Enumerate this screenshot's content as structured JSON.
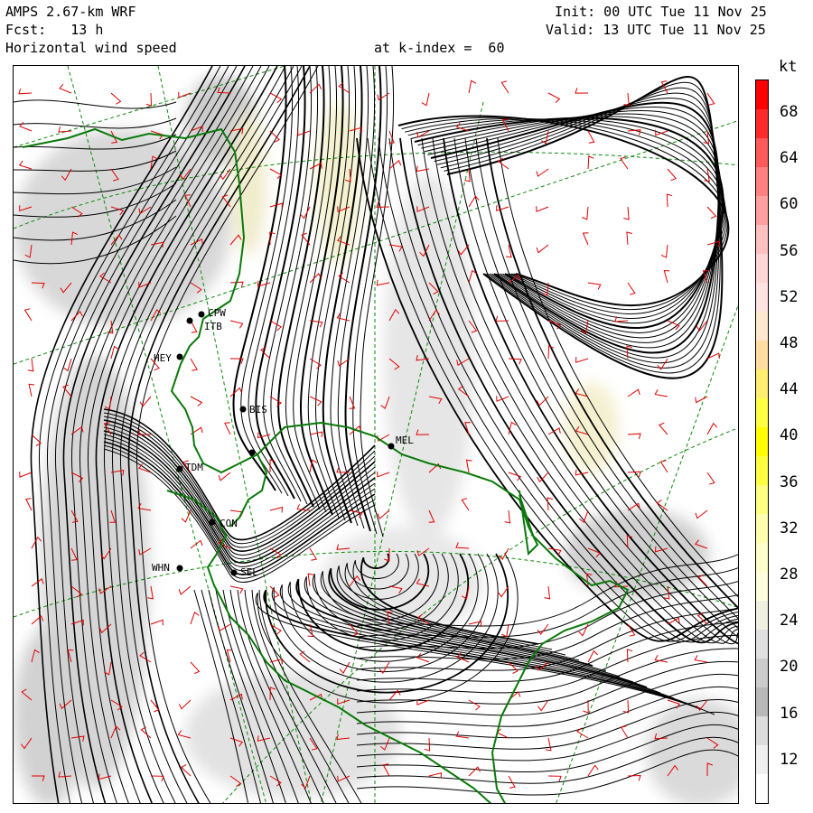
{
  "header": {
    "model": "AMPS 2.67-km WRF",
    "forecast": "Fcst:   13 h",
    "field": "Horizontal wind speed",
    "level": "at k-index =  60",
    "init": "Init: 00 UTC Tue 11 Nov 25",
    "valid": "Valid: 13 UTC Tue 11 Nov 25"
  },
  "colorbar": {
    "unit": "kt",
    "ticks": [
      "68",
      "64",
      "60",
      "56",
      "52",
      "48",
      "44",
      "40",
      "36",
      "32",
      "28",
      "24",
      "20",
      "16",
      "12"
    ],
    "colors": [
      "#ff0000",
      "#ff2a2a",
      "#ff5a5a",
      "#ff8080",
      "#ffa0a0",
      "#ffc0c0",
      "#ffd6d6",
      "#ffe2e2",
      "#ffe8cc",
      "#ffdda0",
      "#ffee70",
      "#ffff44",
      "#ffff00",
      "#ffff40",
      "#ffff80",
      "#ffffb0",
      "#ffffcc",
      "#ffffdc",
      "#f0f0e0",
      "#e0e0e0",
      "#cccccc",
      "#b8b8b8",
      "#dcdcdc",
      "#efefef",
      "#ffffff"
    ]
  },
  "stations": [
    {
      "id": "CPW",
      "label": "CPW"
    },
    {
      "id": "ITB",
      "label": "ITB"
    },
    {
      "id": "HEY",
      "label": "HEY"
    },
    {
      "id": "BIS",
      "label": "BIS"
    },
    {
      "id": "MEL",
      "label": "MEL"
    },
    {
      "id": "TDM",
      "label": "TDM"
    },
    {
      "id": "CON",
      "label": "CON"
    },
    {
      "id": "WHN",
      "label": "WHN"
    },
    {
      "id": "SEL",
      "label": "SEL"
    }
  ],
  "colors": {
    "streamline": "#000000",
    "barb": "#e00000",
    "coast": "#0a7a0a",
    "grid": "#0a8a0a"
  }
}
